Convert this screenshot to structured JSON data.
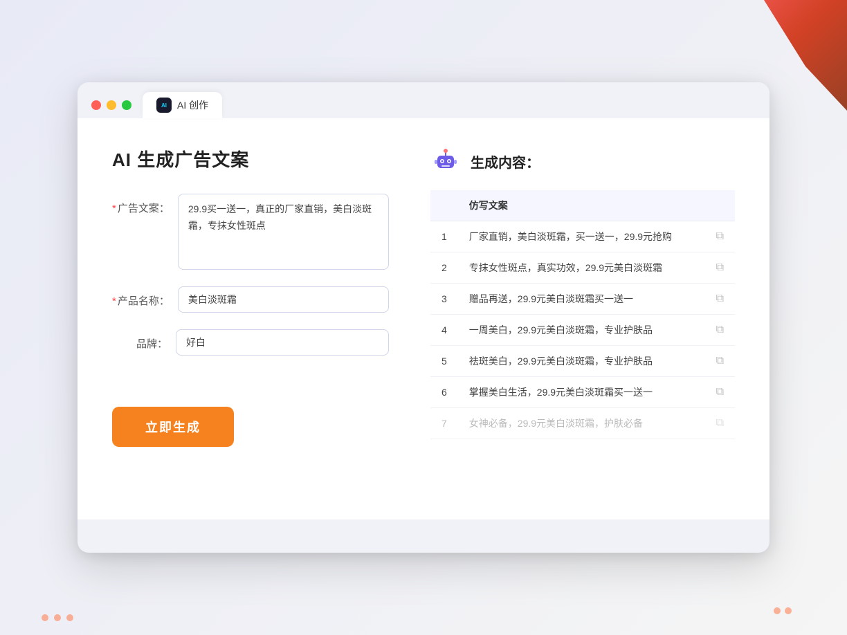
{
  "window": {
    "tab_label": "AI 创作",
    "traffic_lights": [
      "red",
      "yellow",
      "green"
    ]
  },
  "left_panel": {
    "page_title": "AI 生成广告文案",
    "form": {
      "ad_copy_label": "广告文案：",
      "ad_copy_required": "*",
      "ad_copy_value": "29.9买一送一，真正的厂家直销，美白淡斑霜，专抹女性斑点",
      "product_name_label": "产品名称：",
      "product_name_required": "*",
      "product_name_value": "美白淡斑霜",
      "brand_label": "品牌：",
      "brand_value": "好白"
    },
    "generate_button": "立即生成"
  },
  "right_panel": {
    "section_title": "生成内容：",
    "table_header": "仿写文案",
    "results": [
      {
        "num": 1,
        "text": "厂家直销，美白淡斑霜，买一送一，29.9元抢购",
        "dimmed": false
      },
      {
        "num": 2,
        "text": "专抹女性斑点，真实功效，29.9元美白淡斑霜",
        "dimmed": false
      },
      {
        "num": 3,
        "text": "赠品再送，29.9元美白淡斑霜买一送一",
        "dimmed": false
      },
      {
        "num": 4,
        "text": "一周美白，29.9元美白淡斑霜，专业护肤品",
        "dimmed": false
      },
      {
        "num": 5,
        "text": "祛斑美白，29.9元美白淡斑霜，专业护肤品",
        "dimmed": false
      },
      {
        "num": 6,
        "text": "掌握美白生活，29.9元美白淡斑霜买一送一",
        "dimmed": false
      },
      {
        "num": 7,
        "text": "女神必备，29.9元美白淡斑霜，护肤必备",
        "dimmed": true
      }
    ]
  }
}
